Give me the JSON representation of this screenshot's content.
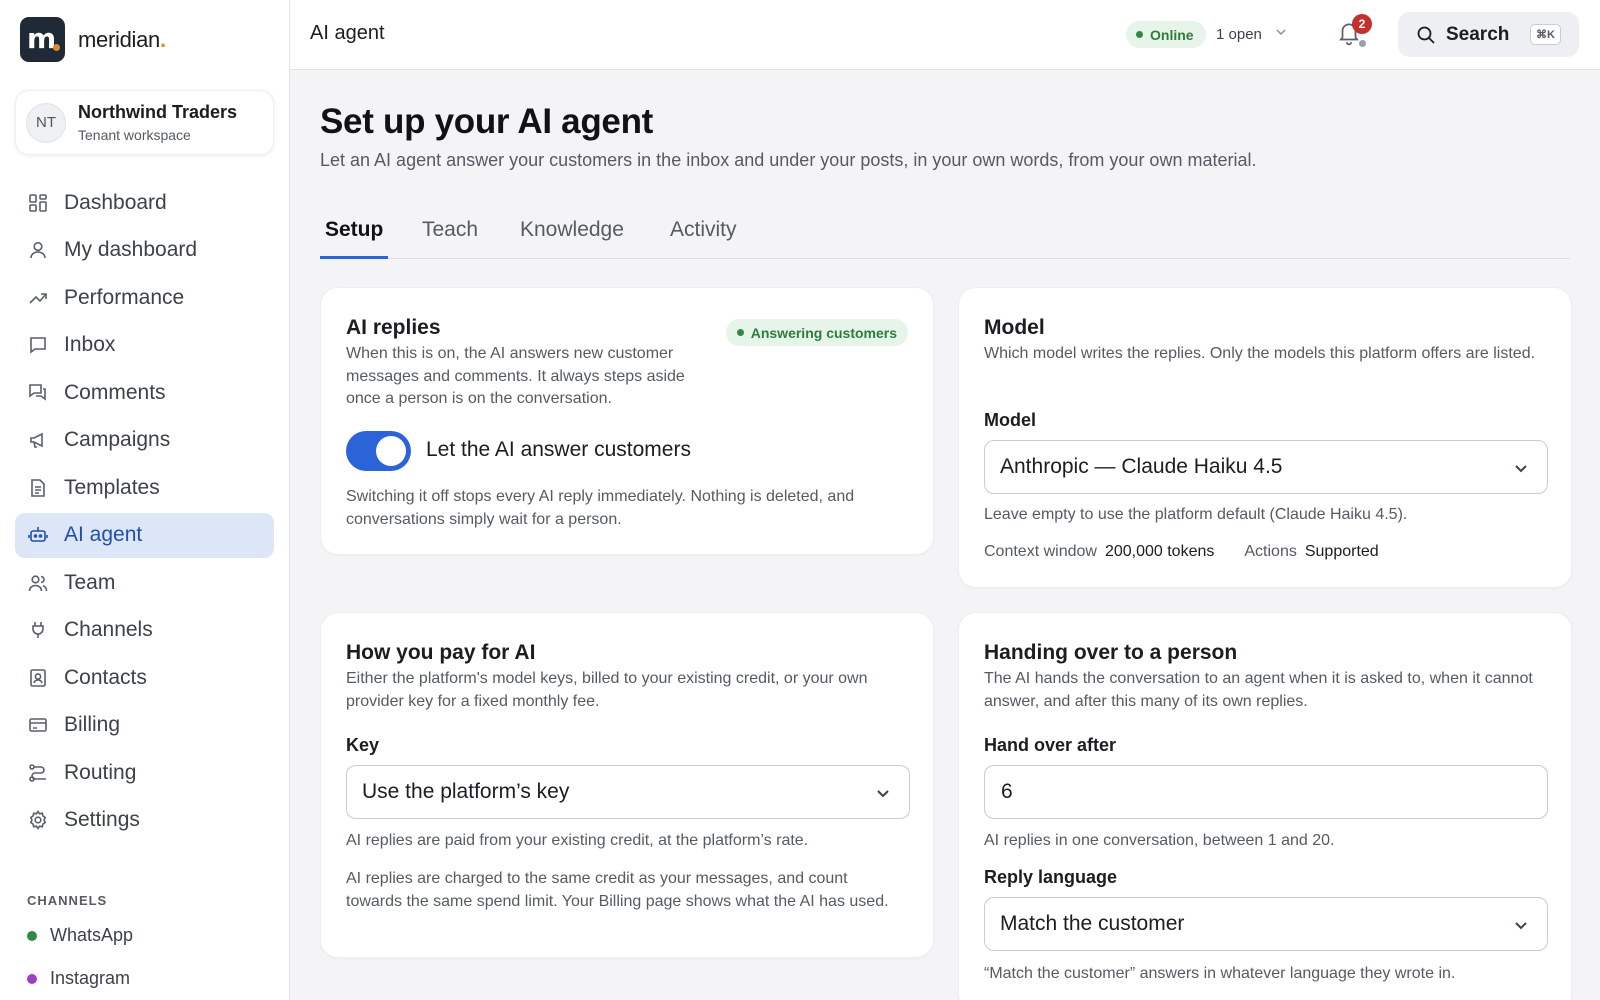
{
  "brand": {
    "logo_letter": "m",
    "name": "meridian",
    "name_suffix": ".",
    "accent": "#e0892b"
  },
  "tenant": {
    "initials": "NT",
    "name": "Northwind Traders",
    "subtitle": "Tenant workspace"
  },
  "nav": {
    "active": "AI agent",
    "items": [
      {
        "label": "Dashboard",
        "icon": "grid-icon"
      },
      {
        "label": "My dashboard",
        "icon": "user-icon"
      },
      {
        "label": "Performance",
        "icon": "trend-icon"
      },
      {
        "label": "Inbox",
        "icon": "message-icon"
      },
      {
        "label": "Comments",
        "icon": "comments-icon"
      },
      {
        "label": "Campaigns",
        "icon": "megaphone-icon"
      },
      {
        "label": "Templates",
        "icon": "document-icon"
      },
      {
        "label": "AI agent",
        "icon": "bot-icon"
      },
      {
        "label": "Team",
        "icon": "team-icon"
      },
      {
        "label": "Channels",
        "icon": "plug-icon"
      },
      {
        "label": "Contacts",
        "icon": "contact-icon"
      },
      {
        "label": "Billing",
        "icon": "card-icon"
      },
      {
        "label": "Routing",
        "icon": "routing-icon"
      },
      {
        "label": "Settings",
        "icon": "gear-icon"
      }
    ]
  },
  "channels": {
    "title": "CHANNELS",
    "items": [
      {
        "label": "WhatsApp",
        "color": "#2e8a3f"
      },
      {
        "label": "Instagram",
        "color": "#9b3fc4"
      }
    ]
  },
  "topbar": {
    "title": "AI agent",
    "status": "Online",
    "open_count": "1 open",
    "notifications": "2",
    "search_label": "Search",
    "search_shortcut": "⌘K"
  },
  "page": {
    "title": "Set up your AI agent",
    "subtitle": "Let an AI agent answer your customers in the inbox and under your posts, in your own words, from your own material."
  },
  "tabs": [
    "Setup",
    "Teach",
    "Knowledge",
    "Activity"
  ],
  "ai_replies": {
    "title": "AI replies",
    "badge": "Answering customers",
    "description": "When this is on, the AI answers new customer messages and comments. It always steps aside once a person is on the conversation.",
    "toggle_label": "Let the AI answer customers",
    "toggle_on": true,
    "note": "Switching it off stops every AI reply immediately. Nothing is deleted, and conversations simply wait for a person."
  },
  "model": {
    "title": "Model",
    "description": "Which model writes the replies. Only the models this platform offers are listed.",
    "field_label": "Model",
    "selected": "Anthropic — Claude Haiku 4.5",
    "help": "Leave empty to use the platform default (Claude Haiku 4.5).",
    "context_label": "Context window",
    "context_value": "200,000 tokens",
    "actions_label": "Actions",
    "actions_value": "Supported"
  },
  "payment": {
    "title": "How you pay for AI",
    "description": "Either the platform's model keys, billed to your existing credit, or your own provider key for a fixed monthly fee.",
    "field_label": "Key",
    "selected": "Use the platform’s key",
    "help": "AI replies are paid from your existing credit, at the platform’s rate.",
    "note": "AI replies are charged to the same credit as your messages, and count towards the same spend limit. Your Billing page shows what the AI has used."
  },
  "handover": {
    "title": "Handing over to a person",
    "description": "The AI hands the conversation to an agent when it is asked to, when it cannot answer, and after this many of its own replies.",
    "field_label": "Hand over after",
    "value": "6",
    "help": "AI replies in one conversation, between 1 and 20.",
    "language_label": "Reply language",
    "language_selected": "Match the customer",
    "language_help": "“Match the customer” answers in whatever language they wrote in."
  }
}
